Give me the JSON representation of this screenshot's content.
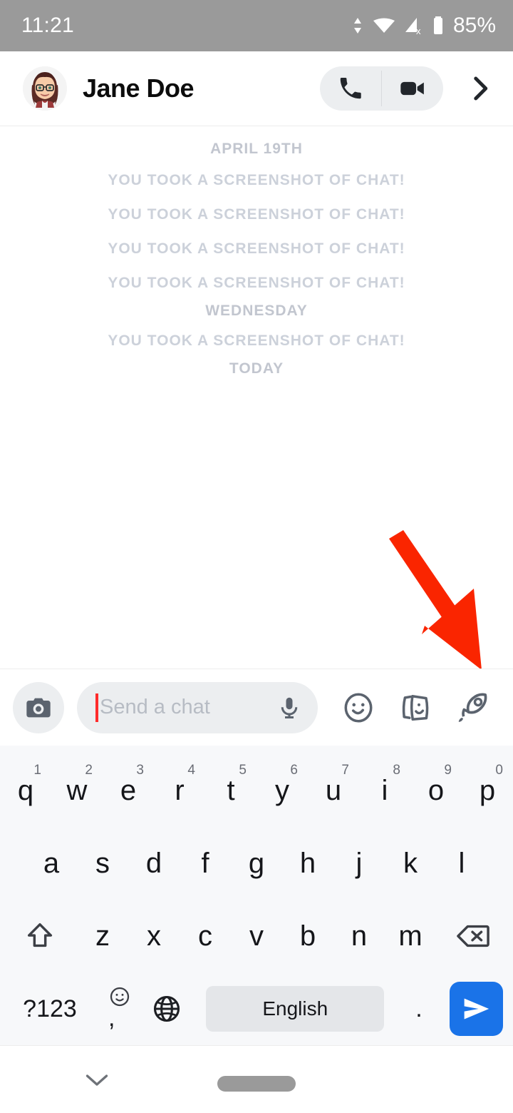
{
  "status_bar": {
    "time": "11:21",
    "battery_percent": "85%",
    "icons": [
      "data-transfer-icon",
      "wifi-icon",
      "cellular-signal-off-icon",
      "battery-icon"
    ],
    "background_color": "#9a9a9a",
    "text_color": "#ffffff"
  },
  "header": {
    "contact_name": "Jane Doe",
    "avatar_name": "bitmoji-avatar",
    "voice_call_icon": "phone-icon",
    "video_call_icon": "video-camera-icon",
    "forward_icon": "chevron-right-icon",
    "pill_background": "#eceef0"
  },
  "chat": {
    "messages": [
      {
        "type": "date-divider",
        "text": "APRIL 19TH"
      },
      {
        "type": "screenshot-notice",
        "text": "YOU TOOK A SCREENSHOT OF CHAT!"
      },
      {
        "type": "screenshot-notice",
        "text": "YOU TOOK A SCREENSHOT OF CHAT!"
      },
      {
        "type": "screenshot-notice",
        "text": "YOU TOOK A SCREENSHOT OF CHAT!"
      },
      {
        "type": "screenshot-notice",
        "text": "YOU TOOK A SCREENSHOT OF CHAT!"
      },
      {
        "type": "date-divider",
        "text": "WEDNESDAY"
      },
      {
        "type": "screenshot-notice",
        "text": "YOU TOOK A SCREENSHOT OF CHAT!"
      },
      {
        "type": "date-divider",
        "text": "TODAY"
      }
    ],
    "annotation": {
      "shape": "red-arrow",
      "color": "#fa2500",
      "points_to": "rocket-icon"
    }
  },
  "input_bar": {
    "camera_icon": "camera-icon",
    "placeholder": "Send a chat",
    "value": "",
    "mic_icon": "microphone-icon",
    "actions": [
      {
        "name": "sticker-smiley-icon",
        "label": "Bitmoji stickers"
      },
      {
        "name": "sticker-cards-icon",
        "label": "Stickers"
      },
      {
        "name": "rocket-icon",
        "label": "Games and Mini apps"
      }
    ],
    "field_background": "#eceef0",
    "caret_color": "#ff2b2b"
  },
  "keyboard": {
    "row1": [
      {
        "key": "q",
        "sup": "1"
      },
      {
        "key": "w",
        "sup": "2"
      },
      {
        "key": "e",
        "sup": "3"
      },
      {
        "key": "r",
        "sup": "4"
      },
      {
        "key": "t",
        "sup": "5"
      },
      {
        "key": "y",
        "sup": "6"
      },
      {
        "key": "u",
        "sup": "7"
      },
      {
        "key": "i",
        "sup": "8"
      },
      {
        "key": "o",
        "sup": "9"
      },
      {
        "key": "p",
        "sup": "0"
      }
    ],
    "row2": [
      {
        "key": "a"
      },
      {
        "key": "s"
      },
      {
        "key": "d"
      },
      {
        "key": "f"
      },
      {
        "key": "g"
      },
      {
        "key": "h"
      },
      {
        "key": "j"
      },
      {
        "key": "k"
      },
      {
        "key": "l"
      }
    ],
    "row3": {
      "shift_icon": "shift-up-arrow-icon",
      "keys": [
        {
          "key": "z"
        },
        {
          "key": "x"
        },
        {
          "key": "c"
        },
        {
          "key": "v"
        },
        {
          "key": "b"
        },
        {
          "key": "n"
        },
        {
          "key": "m"
        }
      ],
      "backspace_icon": "backspace-icon"
    },
    "row4": {
      "symbols_label": "?123",
      "emoji_icon": "emoji-smiley-icon",
      "comma_label": ",",
      "language_icon": "globe-icon",
      "spacebar_label": "English",
      "period_label": ".",
      "send_icon": "send-paper-plane-icon",
      "send_background": "#1a73e8"
    },
    "background_color": "#f7f8fa"
  },
  "nav_bar": {
    "hide_keyboard_icon": "chevron-down-icon",
    "gesture_pill": "home-gesture-pill"
  }
}
